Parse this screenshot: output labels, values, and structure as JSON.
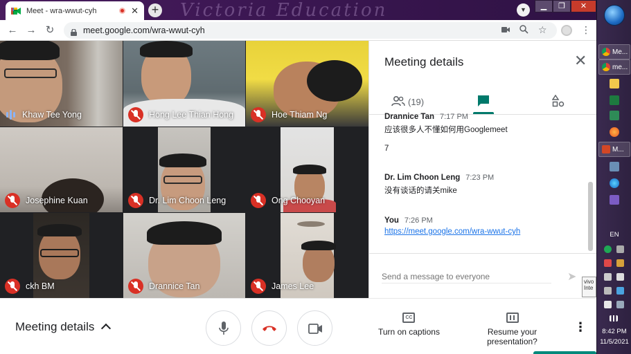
{
  "browser": {
    "tab_title": "Meet - wra-wwut-cyh",
    "new_tab": "+",
    "url": "meet.google.com/wra-wwut-cyh"
  },
  "grid": {
    "tiles": [
      {
        "name": "Khaw Tee Yong",
        "muted": false
      },
      {
        "name": "Hong Lee Thian Hong",
        "muted": true
      },
      {
        "name": "Hoe Thiam Ng",
        "muted": true
      },
      {
        "name": "Josephine Kuan",
        "muted": true
      },
      {
        "name": "Dr. Lim Choon Leng",
        "muted": true
      },
      {
        "name": "Ong Chooyan",
        "muted": true
      },
      {
        "name": "ckh BM",
        "muted": true
      },
      {
        "name": "Drannice Tan",
        "muted": true
      },
      {
        "name": "James Lee",
        "muted": true
      }
    ]
  },
  "panel": {
    "title": "Meeting details",
    "people_count": "(19)",
    "messages": [
      {
        "sender": "Drannice Tan",
        "time": "7:17 PM",
        "lines": [
          "应该很多人不懂如何用Googlemeet",
          "7"
        ]
      },
      {
        "sender": "Dr. Lim Choon Leng",
        "time": "7:23 PM",
        "lines": [
          "没有谈话的请关mike"
        ]
      },
      {
        "sender": "You",
        "time": "7:26 PM",
        "link": "https://meet.google.com/wra-wwut-cyh"
      }
    ],
    "input_placeholder": "Send a message to everyone"
  },
  "bottom": {
    "meeting_details": "Meeting details",
    "captions_label": "Turn on captions",
    "captions_icon_text": "CC",
    "present_label_1": "Resume your",
    "present_label_2": "presentation?"
  },
  "taskbar": {
    "apps": [
      "Me...",
      "me...",
      "M..."
    ],
    "language": "EN",
    "time": "8:42 PM",
    "date": "11/5/2021",
    "tooltip": "vivo Inte"
  },
  "colors": {
    "accent": "#00796b",
    "muted_red": "#d93025",
    "link": "#1a73e8",
    "speaking": "#8ab4f8"
  }
}
